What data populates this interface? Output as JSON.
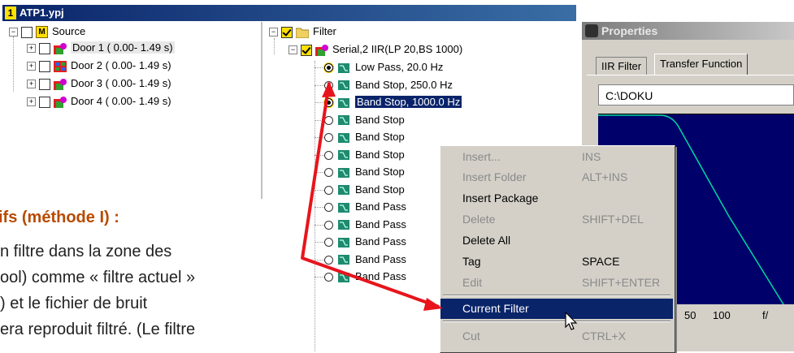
{
  "window": {
    "number_badge": "1",
    "title": "ATP1.ypj"
  },
  "source_tree": {
    "root": {
      "badge": "M",
      "label": "Source"
    },
    "items": [
      {
        "label": "Door 1 ( 0.00- 1.49 s)"
      },
      {
        "label": "Door 2 ( 0.00- 1.49 s)"
      },
      {
        "label": "Door 3 ( 0.00- 1.49 s)"
      },
      {
        "label": "Door 4 ( 0.00- 1.49 s)"
      }
    ]
  },
  "filter_tree": {
    "root_label": "Filter",
    "package_label": "Serial,2 IIR(LP 20,BS 1000)",
    "items": [
      {
        "label": "Low Pass, 20.0 Hz",
        "active": true
      },
      {
        "label": "Band Stop, 250.0 Hz",
        "active": false
      },
      {
        "label": "Band Stop, 1000.0 Hz",
        "active": true,
        "selected": true
      },
      {
        "label": "Band Stop",
        "active": false
      },
      {
        "label": "Band Stop",
        "active": false
      },
      {
        "label": "Band Stop",
        "active": false
      },
      {
        "label": "Band Stop",
        "active": false
      },
      {
        "label": "Band Stop",
        "active": false
      },
      {
        "label": "Band Pass",
        "active": false
      },
      {
        "label": "Band Pass",
        "active": false
      },
      {
        "label": "Band Pass",
        "active": false
      },
      {
        "label": "Band Pass",
        "active": false
      },
      {
        "label": "Band Pass",
        "active": false
      }
    ]
  },
  "properties": {
    "title": "Properties",
    "tabs": [
      {
        "label": "IIR Filter"
      },
      {
        "label": "Transfer Function"
      }
    ],
    "path": "C:\\DOKU",
    "axis_ticks": [
      "50",
      "100",
      "f/"
    ]
  },
  "context_menu": {
    "items": [
      {
        "label": "Insert...",
        "shortcut": "INS",
        "enabled": false
      },
      {
        "label": "Insert Folder",
        "shortcut": "ALT+INS",
        "enabled": false
      },
      {
        "label": "Insert Package",
        "shortcut": "",
        "enabled": true
      },
      {
        "label": "Delete",
        "shortcut": "SHIFT+DEL",
        "enabled": false
      },
      {
        "label": "Delete All",
        "shortcut": "",
        "enabled": true
      },
      {
        "label": "Tag",
        "shortcut": "SPACE",
        "enabled": true
      },
      {
        "label": "Edit",
        "shortcut": "SHIFT+ENTER",
        "enabled": false
      },
      {
        "label": "Current Filter",
        "shortcut": "",
        "enabled": true,
        "highlighted": true
      },
      {
        "label": "Cut",
        "shortcut": "CTRL+X",
        "enabled": false
      }
    ]
  },
  "overlay_text": {
    "heading": "ifs (méthode I) :",
    "lines": [
      "n filtre dans la zone des",
      "ool) comme « filtre actuel »",
      ") et le fichier de bruit",
      "era reproduit filtré. (Le filtre"
    ]
  },
  "colors": {
    "annotation_arrow": "#e8141c",
    "highlight": "#0a246a",
    "plot_bg": "#00006b",
    "plot_line": "#00d8a0",
    "heading": "#b84a00"
  }
}
